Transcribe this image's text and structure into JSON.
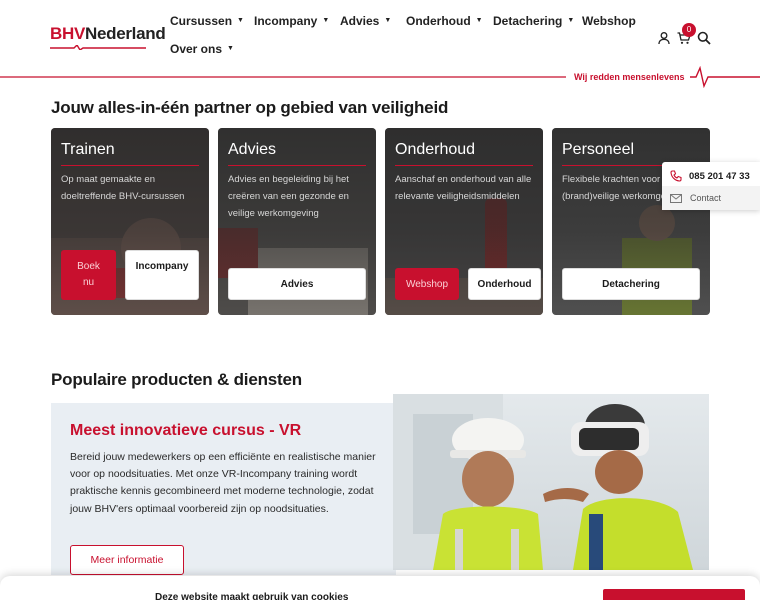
{
  "brand": {
    "logo_text_left": "BHV",
    "logo_text_right": "Nederland",
    "tagline": "Wij redden mensenlevens",
    "accent_color": "#c8102e"
  },
  "nav": {
    "items": [
      {
        "label": "Cursussen",
        "has_dropdown": true
      },
      {
        "label": "Incompany",
        "has_dropdown": true
      },
      {
        "label": "Advies",
        "has_dropdown": true
      },
      {
        "label": "Onderhoud",
        "has_dropdown": true
      },
      {
        "label": "Detachering",
        "has_dropdown": true
      },
      {
        "label": "Webshop",
        "has_dropdown": false
      },
      {
        "label": "Over ons",
        "has_dropdown": true
      }
    ],
    "cart_count": "0",
    "icons": [
      "user-icon",
      "cart-icon",
      "search-icon"
    ]
  },
  "hero": {
    "title": "Jouw alles-in-één partner op gebied van veiligheid"
  },
  "cards": [
    {
      "title": "Trainen",
      "text": "Op maat gemaakte en doeltreffende BHV-cursussen",
      "buttons": [
        {
          "label": "Boek nu",
          "style": "red"
        },
        {
          "label": "Incompany",
          "style": "white"
        }
      ]
    },
    {
      "title": "Advies",
      "text": "Advies en begeleiding bij het creëren van een gezonde en veilige werkomgeving",
      "buttons": [
        {
          "label": "Advies",
          "style": "white"
        }
      ]
    },
    {
      "title": "Onderhoud",
      "text": "Aanschaf en onderhoud van alle relevante veiligheidsmiddelen",
      "buttons": [
        {
          "label": "Webshop",
          "style": "red"
        },
        {
          "label": "Onderhoud",
          "style": "white"
        }
      ]
    },
    {
      "title": "Personeel",
      "text": "Flexibele krachten voor (brand)veilige werkomgevingen",
      "buttons": [
        {
          "label": "Detachering",
          "style": "white"
        }
      ]
    }
  ],
  "side_widget": {
    "phone": "085 201 47 33",
    "contact_label": "Contact"
  },
  "popular": {
    "title": "Populaire producten & diensten",
    "promo_title": "Meest innovatieve cursus - VR",
    "promo_text": "Bereid jouw medewerkers op een efficiënte en realistische manier voor op noodsituaties. Met onze VR-Incompany training wordt praktische kennis gecombineerd met moderne technologie, zodat jouw BHV'ers optimaal voorbereid zijn op noodsituaties.",
    "promo_button": "Meer informatie"
  },
  "cookie": {
    "text": "Deze website maakt gebruik van cookies"
  }
}
